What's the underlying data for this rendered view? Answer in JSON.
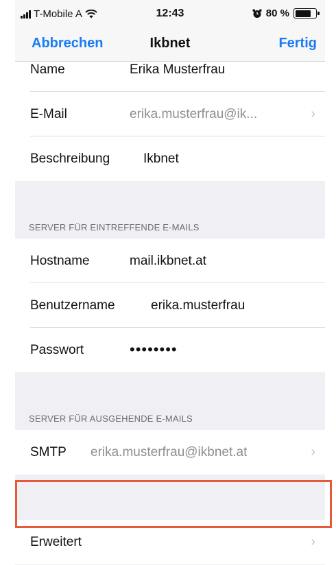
{
  "status_bar": {
    "carrier": "T-Mobile A",
    "time": "12:43",
    "battery": "80 %",
    "battery_level": 0.8,
    "icons": [
      "signal-icon",
      "wifi-icon",
      "alarm-icon",
      "battery-icon"
    ]
  },
  "nav": {
    "cancel_label": "Abbrechen",
    "title": "Ikbnet",
    "done_label": "Fertig",
    "accent_color": "#1a7cf5"
  },
  "account": {
    "name_label": "Name",
    "name_value": "Erika Musterfrau",
    "email_label": "E-Mail",
    "email_value": "erika.musterfrau@ik...",
    "description_label": "Beschreibung",
    "description_value": "Ikbnet"
  },
  "incoming": {
    "header": "SERVER FÜR EINTREFFENDE E-MAILS",
    "hostname_label": "Hostname",
    "hostname_value": "mail.ikbnet.at",
    "username_label": "Benutzername",
    "username_value": "erika.musterfrau",
    "password_label": "Passwort",
    "password_value": "••••••••"
  },
  "outgoing": {
    "header": "SERVER FÜR AUSGEHENDE E-MAILS",
    "smtp_label": "SMTP",
    "smtp_value": "erika.musterfrau@ikbnet.at"
  },
  "advanced": {
    "label": "Erweitert",
    "highlight_color": "#e8583a"
  },
  "chevron": "›"
}
